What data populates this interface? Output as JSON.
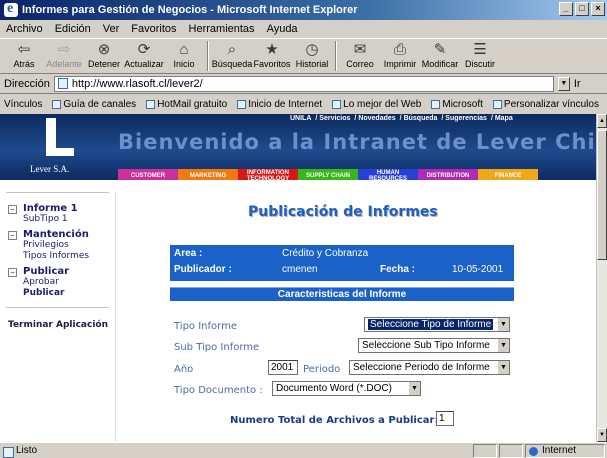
{
  "window": {
    "title": "Informes para Gestión de Negocios - Microsoft Internet Explorer"
  },
  "menu": [
    "Archivo",
    "Edición",
    "Ver",
    "Favoritos",
    "Herramientas",
    "Ayuda"
  ],
  "toolbar": {
    "back": "Atrás",
    "forward": "Adelante",
    "stop": "Detener",
    "refresh": "Actualizar",
    "home": "Inicio",
    "search": "Búsqueda",
    "favorites": "Favoritos",
    "history": "Historial",
    "mail": "Correo",
    "print": "Imprimir",
    "edit": "Modificar",
    "discuss": "Discutir"
  },
  "address": {
    "label": "Dirección",
    "url": "http://www.rlasoft.cl/lever2/",
    "go": "Ir"
  },
  "links": {
    "label": "Vínculos",
    "items": [
      "Guía de canales",
      "HotMail gratuito",
      "Inicio de Internet",
      "Lo mejor del Web",
      "Microsoft",
      "Personalizar vínculos"
    ]
  },
  "banner": {
    "top_links": [
      "UNILA",
      "Servicios",
      "Novedades",
      "Búsqueda",
      "Sugerencias",
      "Mapa"
    ],
    "welcome": "Bienvenido a la Intranet de Lever Chile",
    "company": "Lever S.A.",
    "nav": [
      {
        "label": "CUSTOMER",
        "color": "#cc2e9a"
      },
      {
        "label": "MARKETING",
        "color": "#f07a10"
      },
      {
        "label": "INFORMATION TECHNOLOGY",
        "color": "#d81818"
      },
      {
        "label": "SUPPLY CHAIN",
        "color": "#38b818"
      },
      {
        "label": "HUMAN RESOURCES",
        "color": "#2a3ed8"
      },
      {
        "label": "DISTRIBUTION",
        "color": "#b02ab8"
      },
      {
        "label": "FINANCE",
        "color": "#f0a818"
      }
    ]
  },
  "sidebar": {
    "tree": [
      {
        "label": "Informe 1",
        "children": [
          "SubTipo 1"
        ]
      },
      {
        "label": "Mantención",
        "children": [
          "Privilegios",
          "Tipos Informes"
        ]
      },
      {
        "label": "Publicar",
        "children": [
          "Aprobar",
          "Publicar"
        ]
      }
    ],
    "exit": "Terminar Aplicación"
  },
  "page": {
    "title": "Publicación de Informes",
    "info": {
      "area_label": "Area :",
      "area_value": "Crédito y Cobranza",
      "publisher_label": "Publicador :",
      "publisher_value": "cmenen",
      "date_label": "Fecha :",
      "date_value": "10-05-2001"
    },
    "section_title": "Caracteristicas del Informe",
    "form": {
      "tipo_label": "Tipo Informe",
      "tipo_value": "Seleccione Tipo de Informe",
      "subtipo_label": "Sub Tipo Informe",
      "subtipo_value": "Seleccione Sub Tipo Informe",
      "anio_label": "Año",
      "anio_value": "2001",
      "periodo_label": "Periodo",
      "periodo_value": "Seleccione Periodo de Informe",
      "doc_label": "Tipo Documento :",
      "doc_value": "Documento Word (*.DOC)",
      "total_label": "Numero Total de Archivos a Publicar:",
      "total_value": "1"
    }
  },
  "status": {
    "text": "Listo",
    "zone": "Internet"
  }
}
